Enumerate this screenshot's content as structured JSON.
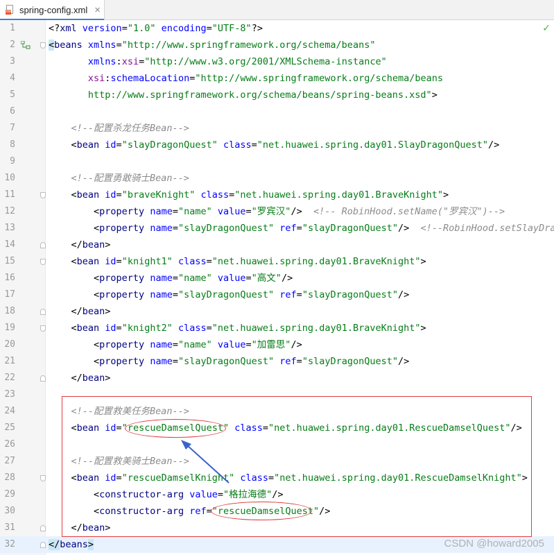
{
  "tab": {
    "filename": "spring-config.xml",
    "close": "×",
    "file_badge": "XML"
  },
  "status": {
    "check": "✓"
  },
  "lines": [
    {
      "n": "1",
      "tokens": [
        {
          "k": "p",
          "t": "<?"
        },
        {
          "k": "t",
          "t": "xml "
        },
        {
          "k": "a",
          "t": "version"
        },
        {
          "k": "p",
          "t": "="
        },
        {
          "k": "v",
          "t": "\"1.0\""
        },
        {
          "k": "p",
          "t": " "
        },
        {
          "k": "a",
          "t": "encoding"
        },
        {
          "k": "p",
          "t": "="
        },
        {
          "k": "v",
          "t": "\"UTF-8\""
        },
        {
          "k": "p",
          "t": "?>"
        }
      ]
    },
    {
      "n": "2",
      "tokens": [
        {
          "k": "brk",
          "t": "<"
        },
        {
          "k": "t",
          "t": "beans "
        },
        {
          "k": "a",
          "t": "xmlns"
        },
        {
          "k": "p",
          "t": "="
        },
        {
          "k": "v",
          "t": "\"http://www.springframework.org/schema/beans\""
        }
      ]
    },
    {
      "n": "3",
      "tokens": [
        {
          "k": "p",
          "t": "       "
        },
        {
          "k": "a",
          "t": "xmlns"
        },
        {
          "k": "p",
          "t": ":"
        },
        {
          "k": "ns",
          "t": "xsi"
        },
        {
          "k": "p",
          "t": "="
        },
        {
          "k": "v",
          "t": "\"http://www.w3.org/2001/XMLSchema-instance\""
        }
      ]
    },
    {
      "n": "4",
      "tokens": [
        {
          "k": "p",
          "t": "       "
        },
        {
          "k": "ns",
          "t": "xsi"
        },
        {
          "k": "p",
          "t": ":"
        },
        {
          "k": "a",
          "t": "schemaLocation"
        },
        {
          "k": "p",
          "t": "="
        },
        {
          "k": "v",
          "t": "\"http://www.springframework.org/schema/beans"
        }
      ]
    },
    {
      "n": "5",
      "tokens": [
        {
          "k": "v",
          "t": "       http://www.springframework.org/schema/beans/spring-beans.xsd\""
        },
        {
          "k": "p",
          "t": ">"
        }
      ]
    },
    {
      "n": "6",
      "tokens": []
    },
    {
      "n": "7",
      "tokens": [
        {
          "k": "p",
          "t": "    "
        },
        {
          "k": "c",
          "t": "<!--配置杀龙任务Bean-->"
        }
      ]
    },
    {
      "n": "8",
      "tokens": [
        {
          "k": "p",
          "t": "    <"
        },
        {
          "k": "t",
          "t": "bean "
        },
        {
          "k": "a",
          "t": "id"
        },
        {
          "k": "p",
          "t": "="
        },
        {
          "k": "v",
          "t": "\"slayDragonQuest\""
        },
        {
          "k": "p",
          "t": " "
        },
        {
          "k": "a",
          "t": "class"
        },
        {
          "k": "p",
          "t": "="
        },
        {
          "k": "v",
          "t": "\"net.huawei.spring.day01.SlayDragonQuest\""
        },
        {
          "k": "p",
          "t": "/>"
        }
      ]
    },
    {
      "n": "9",
      "tokens": []
    },
    {
      "n": "10",
      "tokens": [
        {
          "k": "p",
          "t": "    "
        },
        {
          "k": "c",
          "t": "<!--配置勇敢骑士Bean-->"
        }
      ]
    },
    {
      "n": "11",
      "tokens": [
        {
          "k": "p",
          "t": "    <"
        },
        {
          "k": "t",
          "t": "bean "
        },
        {
          "k": "a",
          "t": "id"
        },
        {
          "k": "p",
          "t": "="
        },
        {
          "k": "v",
          "t": "\"braveKnight\""
        },
        {
          "k": "p",
          "t": " "
        },
        {
          "k": "a",
          "t": "class"
        },
        {
          "k": "p",
          "t": "="
        },
        {
          "k": "v",
          "t": "\"net.huawei.spring.day01.BraveKnight\""
        },
        {
          "k": "p",
          "t": ">"
        }
      ]
    },
    {
      "n": "12",
      "tokens": [
        {
          "k": "p",
          "t": "        <"
        },
        {
          "k": "t",
          "t": "property "
        },
        {
          "k": "a",
          "t": "name"
        },
        {
          "k": "p",
          "t": "="
        },
        {
          "k": "v",
          "t": "\"name\""
        },
        {
          "k": "p",
          "t": " "
        },
        {
          "k": "a",
          "t": "value"
        },
        {
          "k": "p",
          "t": "="
        },
        {
          "k": "v",
          "t": "\"罗宾汉\""
        },
        {
          "k": "p",
          "t": "/>  "
        },
        {
          "k": "c",
          "t": "<!-- RobinHood.setName(\"罗宾汉\")-->"
        }
      ]
    },
    {
      "n": "13",
      "tokens": [
        {
          "k": "p",
          "t": "        <"
        },
        {
          "k": "t",
          "t": "property "
        },
        {
          "k": "a",
          "t": "name"
        },
        {
          "k": "p",
          "t": "="
        },
        {
          "k": "v",
          "t": "\"slayDragonQuest\""
        },
        {
          "k": "p",
          "t": " "
        },
        {
          "k": "a",
          "t": "ref"
        },
        {
          "k": "p",
          "t": "="
        },
        {
          "k": "v",
          "t": "\"slayDragonQuest\""
        },
        {
          "k": "p",
          "t": "/>  "
        },
        {
          "k": "c",
          "t": "<!--RobinHood.setSlayDrag"
        }
      ]
    },
    {
      "n": "14",
      "tokens": [
        {
          "k": "p",
          "t": "    </"
        },
        {
          "k": "t",
          "t": "bean"
        },
        {
          "k": "p",
          "t": ">"
        }
      ]
    },
    {
      "n": "15",
      "tokens": [
        {
          "k": "p",
          "t": "    <"
        },
        {
          "k": "t",
          "t": "bean "
        },
        {
          "k": "a",
          "t": "id"
        },
        {
          "k": "p",
          "t": "="
        },
        {
          "k": "v",
          "t": "\"knight1\""
        },
        {
          "k": "p",
          "t": " "
        },
        {
          "k": "a",
          "t": "class"
        },
        {
          "k": "p",
          "t": "="
        },
        {
          "k": "v",
          "t": "\"net.huawei.spring.day01.BraveKnight\""
        },
        {
          "k": "p",
          "t": ">"
        }
      ]
    },
    {
      "n": "16",
      "tokens": [
        {
          "k": "p",
          "t": "        <"
        },
        {
          "k": "t",
          "t": "property "
        },
        {
          "k": "a",
          "t": "name"
        },
        {
          "k": "p",
          "t": "="
        },
        {
          "k": "v",
          "t": "\"name\""
        },
        {
          "k": "p",
          "t": " "
        },
        {
          "k": "a",
          "t": "value"
        },
        {
          "k": "p",
          "t": "="
        },
        {
          "k": "v",
          "t": "\"高文\""
        },
        {
          "k": "p",
          "t": "/>"
        }
      ]
    },
    {
      "n": "17",
      "tokens": [
        {
          "k": "p",
          "t": "        <"
        },
        {
          "k": "t",
          "t": "property "
        },
        {
          "k": "a",
          "t": "name"
        },
        {
          "k": "p",
          "t": "="
        },
        {
          "k": "v",
          "t": "\"slayDragonQuest\""
        },
        {
          "k": "p",
          "t": " "
        },
        {
          "k": "a",
          "t": "ref"
        },
        {
          "k": "p",
          "t": "="
        },
        {
          "k": "v",
          "t": "\"slayDragonQuest\""
        },
        {
          "k": "p",
          "t": "/>"
        }
      ]
    },
    {
      "n": "18",
      "tokens": [
        {
          "k": "p",
          "t": "    </"
        },
        {
          "k": "t",
          "t": "bean"
        },
        {
          "k": "p",
          "t": ">"
        }
      ]
    },
    {
      "n": "19",
      "tokens": [
        {
          "k": "p",
          "t": "    <"
        },
        {
          "k": "t",
          "t": "bean "
        },
        {
          "k": "a",
          "t": "id"
        },
        {
          "k": "p",
          "t": "="
        },
        {
          "k": "v",
          "t": "\"knight2\""
        },
        {
          "k": "p",
          "t": " "
        },
        {
          "k": "a",
          "t": "class"
        },
        {
          "k": "p",
          "t": "="
        },
        {
          "k": "v",
          "t": "\"net.huawei.spring.day01.BraveKnight\""
        },
        {
          "k": "p",
          "t": ">"
        }
      ]
    },
    {
      "n": "20",
      "tokens": [
        {
          "k": "p",
          "t": "        <"
        },
        {
          "k": "t",
          "t": "property "
        },
        {
          "k": "a",
          "t": "name"
        },
        {
          "k": "p",
          "t": "="
        },
        {
          "k": "v",
          "t": "\"name\""
        },
        {
          "k": "p",
          "t": " "
        },
        {
          "k": "a",
          "t": "value"
        },
        {
          "k": "p",
          "t": "="
        },
        {
          "k": "v",
          "t": "\"加雷思\""
        },
        {
          "k": "p",
          "t": "/>"
        }
      ]
    },
    {
      "n": "21",
      "tokens": [
        {
          "k": "p",
          "t": "        <"
        },
        {
          "k": "t",
          "t": "property "
        },
        {
          "k": "a",
          "t": "name"
        },
        {
          "k": "p",
          "t": "="
        },
        {
          "k": "v",
          "t": "\"slayDragonQuest\""
        },
        {
          "k": "p",
          "t": " "
        },
        {
          "k": "a",
          "t": "ref"
        },
        {
          "k": "p",
          "t": "="
        },
        {
          "k": "v",
          "t": "\"slayDragonQuest\""
        },
        {
          "k": "p",
          "t": "/>"
        }
      ]
    },
    {
      "n": "22",
      "tokens": [
        {
          "k": "p",
          "t": "    </"
        },
        {
          "k": "t",
          "t": "bean"
        },
        {
          "k": "p",
          "t": ">"
        }
      ]
    },
    {
      "n": "23",
      "tokens": []
    },
    {
      "n": "24",
      "tokens": [
        {
          "k": "p",
          "t": "    "
        },
        {
          "k": "c",
          "t": "<!--配置救美任务Bean-->"
        }
      ]
    },
    {
      "n": "25",
      "tokens": [
        {
          "k": "p",
          "t": "    <"
        },
        {
          "k": "t",
          "t": "bean "
        },
        {
          "k": "a",
          "t": "id"
        },
        {
          "k": "p",
          "t": "="
        },
        {
          "k": "v",
          "t": "\"rescueDamselQuest\""
        },
        {
          "k": "p",
          "t": " "
        },
        {
          "k": "a",
          "t": "class"
        },
        {
          "k": "p",
          "t": "="
        },
        {
          "k": "v",
          "t": "\"net.huawei.spring.day01.RescueDamselQuest\""
        },
        {
          "k": "p",
          "t": "/>"
        }
      ]
    },
    {
      "n": "26",
      "tokens": []
    },
    {
      "n": "27",
      "tokens": [
        {
          "k": "p",
          "t": "    "
        },
        {
          "k": "c",
          "t": "<!--配置救美骑士Bean-->"
        }
      ]
    },
    {
      "n": "28",
      "tokens": [
        {
          "k": "p",
          "t": "    <"
        },
        {
          "k": "t",
          "t": "bean "
        },
        {
          "k": "a",
          "t": "id"
        },
        {
          "k": "p",
          "t": "="
        },
        {
          "k": "v",
          "t": "\"rescueDamselKnight\""
        },
        {
          "k": "p",
          "t": " "
        },
        {
          "k": "a",
          "t": "class"
        },
        {
          "k": "p",
          "t": "="
        },
        {
          "k": "v",
          "t": "\"net.huawei.spring.day01.RescueDamselKnight\""
        },
        {
          "k": "p",
          "t": ">"
        }
      ]
    },
    {
      "n": "29",
      "tokens": [
        {
          "k": "p",
          "t": "        <"
        },
        {
          "k": "t",
          "t": "constructor-arg "
        },
        {
          "k": "a",
          "t": "value"
        },
        {
          "k": "p",
          "t": "="
        },
        {
          "k": "v",
          "t": "\"格拉海德\""
        },
        {
          "k": "p",
          "t": "/>"
        }
      ]
    },
    {
      "n": "30",
      "tokens": [
        {
          "k": "p",
          "t": "        <"
        },
        {
          "k": "t",
          "t": "constructor-arg "
        },
        {
          "k": "a",
          "t": "ref"
        },
        {
          "k": "p",
          "t": "="
        },
        {
          "k": "v",
          "t": "\"rescueDamselQuest\""
        },
        {
          "k": "p",
          "t": "/>"
        }
      ]
    },
    {
      "n": "31",
      "tokens": [
        {
          "k": "p",
          "t": "    </"
        },
        {
          "k": "t",
          "t": "bean"
        },
        {
          "k": "p",
          "t": ">"
        }
      ]
    },
    {
      "n": "32",
      "tokens": [
        {
          "k": "brk",
          "t": "</"
        },
        {
          "k": "t",
          "t": "beans"
        },
        {
          "k": "brk",
          "t": ">"
        }
      ]
    }
  ],
  "watermark": "CSDN @howard2005",
  "colors": {
    "tag": "#000080",
    "attr": "#0000ff",
    "value": "#067d17",
    "comment": "#8c8c8c",
    "annotation": "#e03c3c",
    "arrow": "#3a62c9"
  }
}
